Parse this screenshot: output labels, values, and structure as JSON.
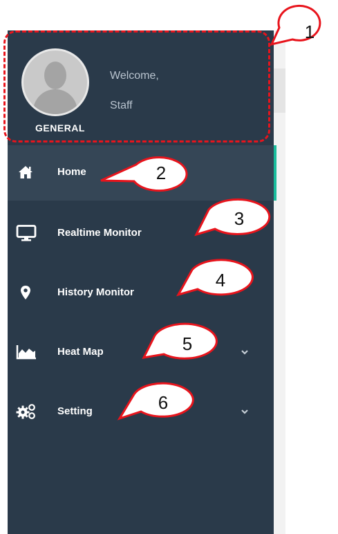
{
  "profile": {
    "welcome": "Welcome,",
    "name": "Staff",
    "role": "GENERAL"
  },
  "menu": [
    {
      "id": "home",
      "label": "Home",
      "icon": "home-icon",
      "active": true,
      "has_submenu": false
    },
    {
      "id": "realtime",
      "label": "Realtime Monitor",
      "icon": "monitor-icon",
      "active": false,
      "has_submenu": false
    },
    {
      "id": "history",
      "label": "History Monitor",
      "icon": "map-marker-icon",
      "active": false,
      "has_submenu": false
    },
    {
      "id": "heatmap",
      "label": "Heat Map",
      "icon": "area-chart-icon",
      "active": false,
      "has_submenu": true
    },
    {
      "id": "setting",
      "label": "Setting",
      "icon": "gears-icon",
      "active": false,
      "has_submenu": true
    }
  ],
  "callouts": [
    "1",
    "2",
    "3",
    "4",
    "5",
    "6"
  ],
  "colors": {
    "sidebar_bg": "#2a3a4a",
    "active_bg": "#354656",
    "accent": "#1abc9c",
    "annotation_red": "#e8141c"
  }
}
